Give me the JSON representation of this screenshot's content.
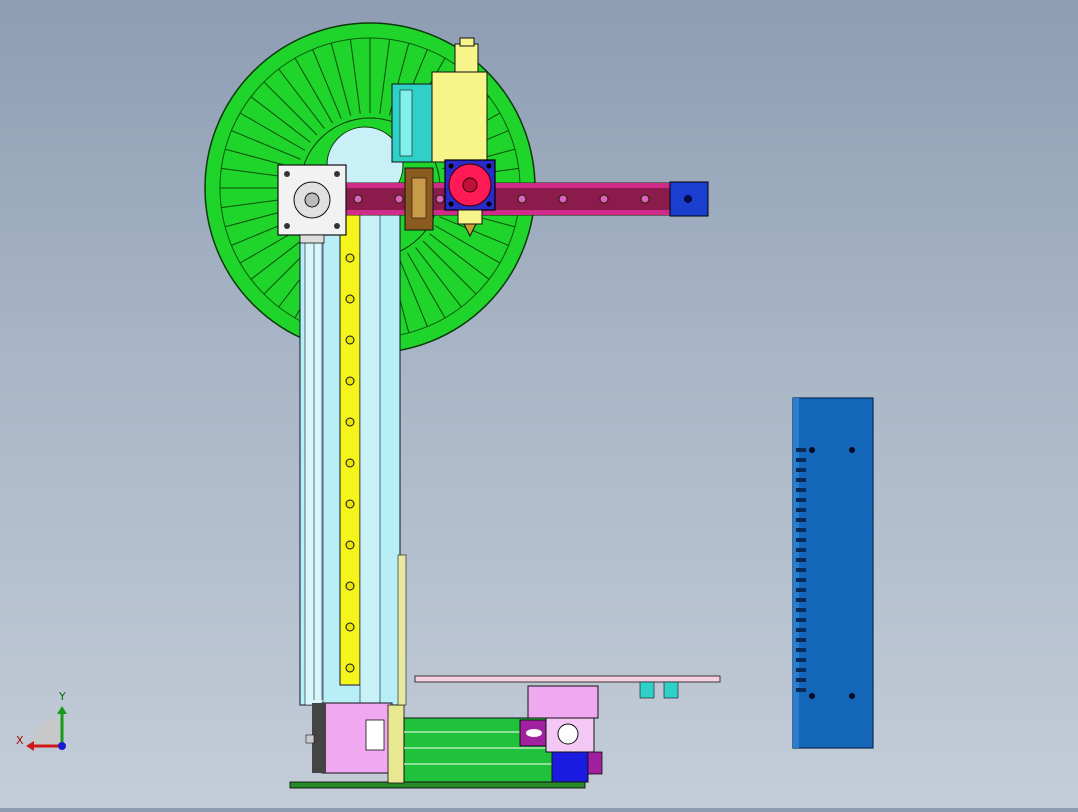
{
  "triad": {
    "x_label": "X",
    "y_label": "Y",
    "icon": "axis-triad-icon"
  },
  "colors": {
    "background_top": "#8e9db3",
    "background_bottom": "#c4cdd8",
    "spool": "#1fd42a",
    "spool_hub": "#c9f0f6",
    "column": "#b8eef5",
    "column_strip": "#f5f51b",
    "rail": "#8a1b4a",
    "rail_end": "#1a3fd0",
    "hotend": "#f7f48a",
    "fan_frame": "#2a2ac8",
    "fan": "#ff1a55",
    "carriage": "#2fd0c8",
    "motor": "#f2f2f2",
    "base_motor": "#f0a8f0",
    "base_rail": "#1fc23a",
    "base_plate": "#2a8a2a",
    "psu": "#1466b8",
    "blue_block": "#1a1ae0",
    "purple": "#a020a0"
  }
}
